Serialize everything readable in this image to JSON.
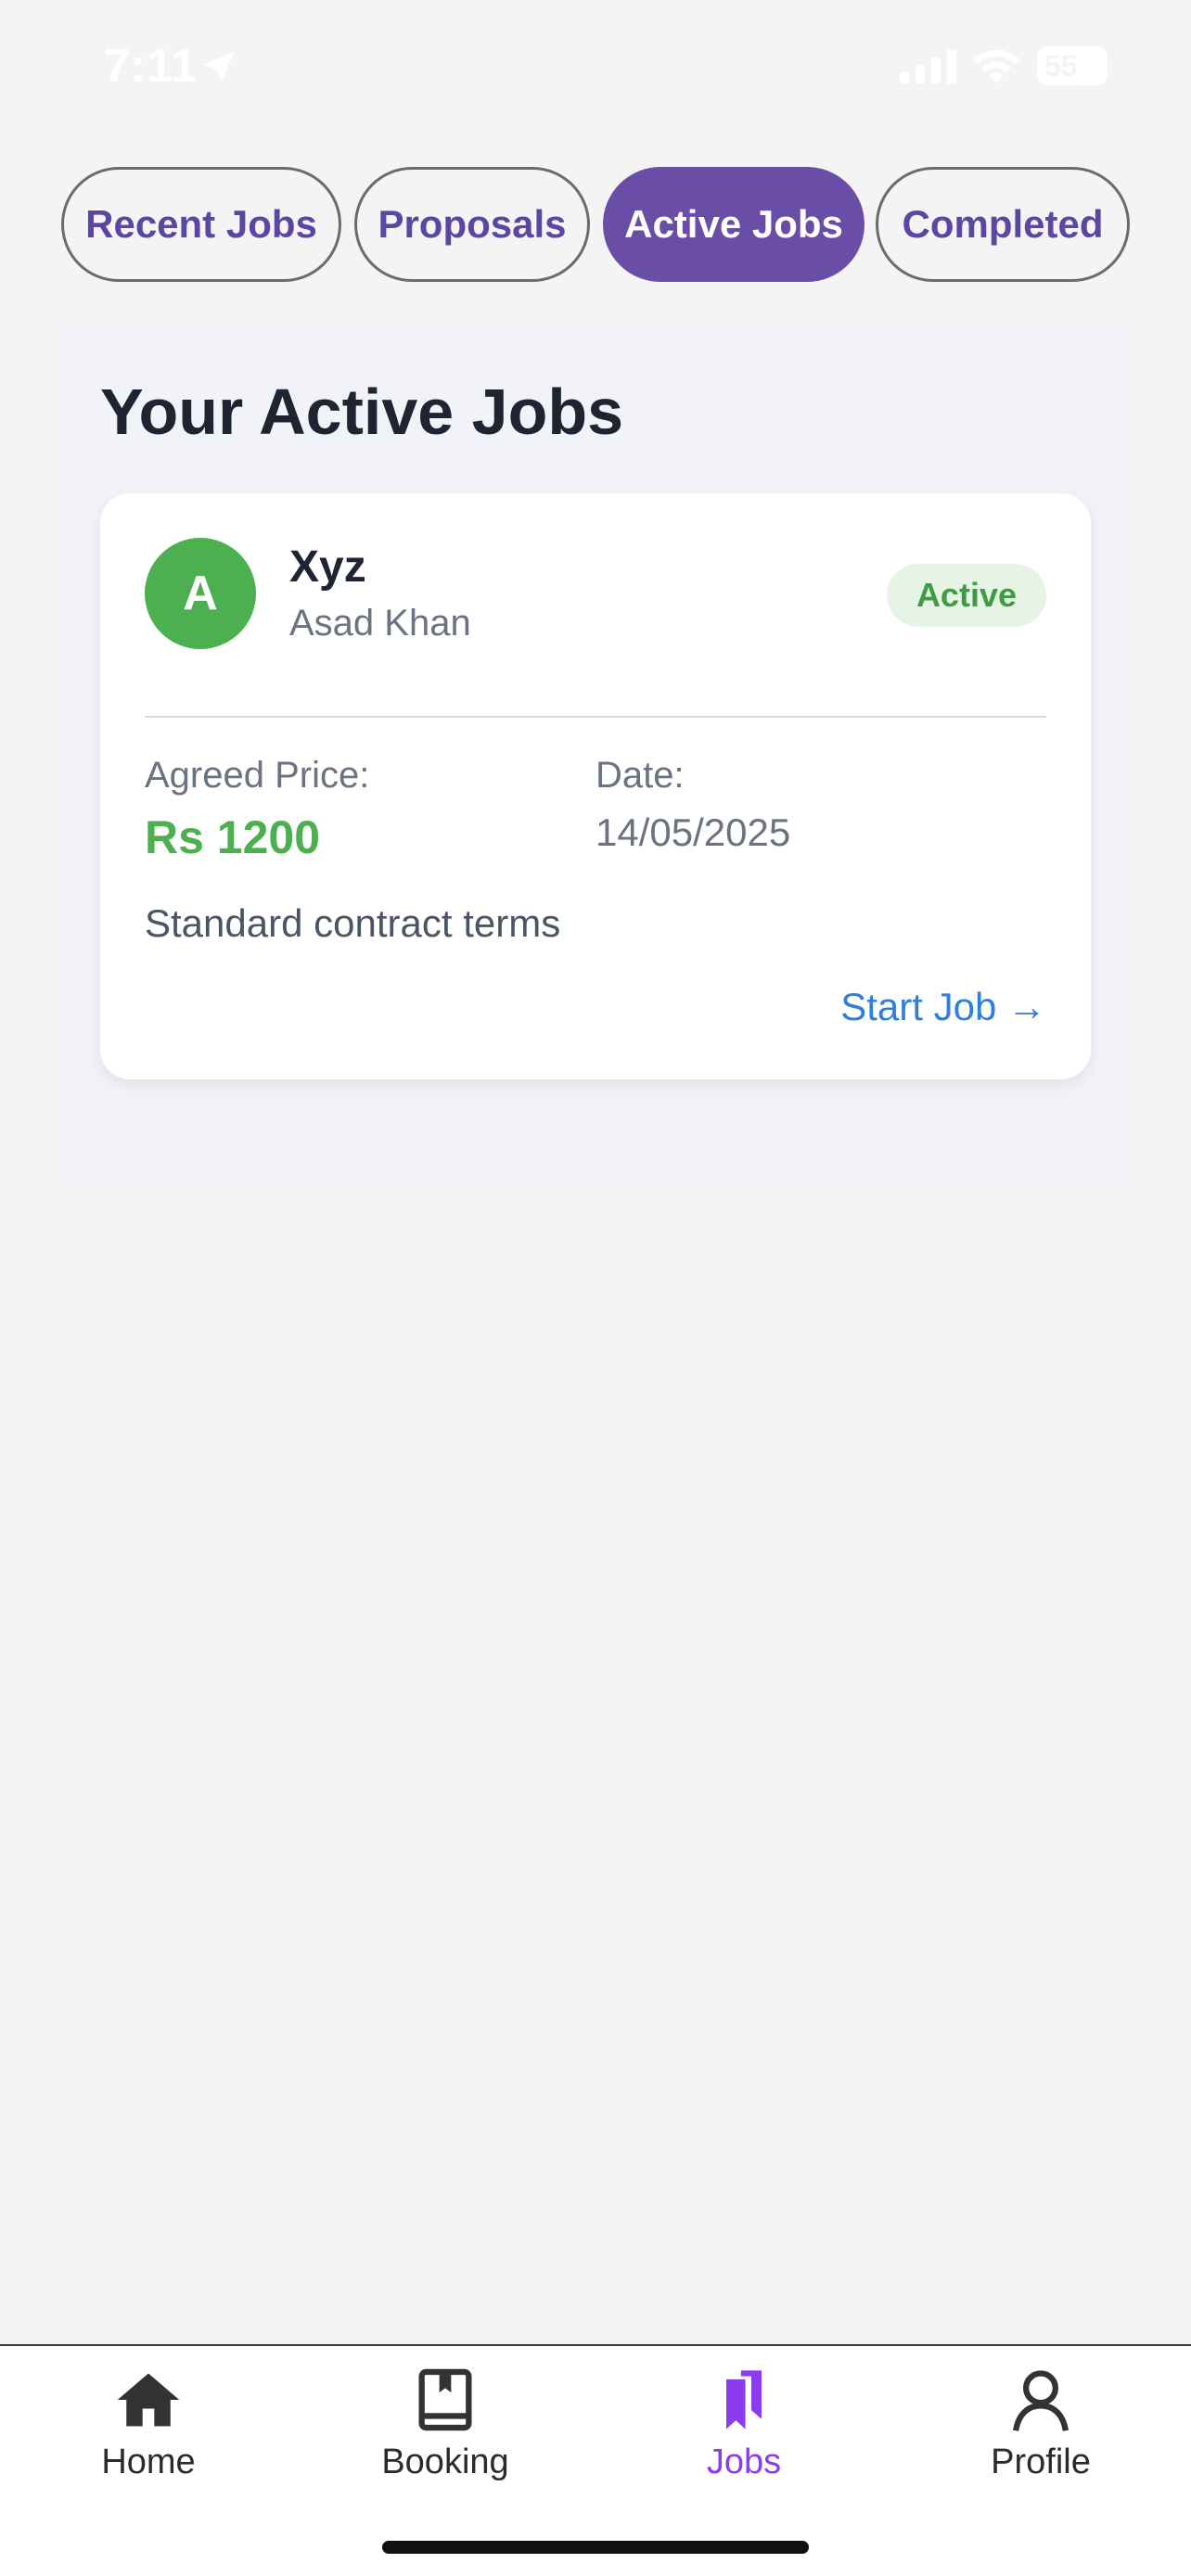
{
  "status_bar": {
    "time": "7:11",
    "battery": "55",
    "icons": [
      "location-arrow-icon",
      "signal-icon",
      "wifi-icon",
      "battery-icon"
    ]
  },
  "tabs": [
    {
      "label": "Recent Jobs",
      "active": false
    },
    {
      "label": "Proposals",
      "active": false
    },
    {
      "label": "Active Jobs",
      "active": true
    },
    {
      "label": "Completed",
      "active": false
    }
  ],
  "section": {
    "title": "Your Active Jobs"
  },
  "job_card": {
    "avatar_letter": "A",
    "title": "Xyz",
    "client": "Asad Khan",
    "status": "Active",
    "price_label": "Agreed Price:",
    "price_value": "Rs 1200",
    "date_label": "Date:",
    "date_value": "14/05/2025",
    "terms": "Standard contract terms",
    "action_label": "Start Job →"
  },
  "bottom_nav": [
    {
      "label": "Home",
      "icon": "home-icon",
      "active": false
    },
    {
      "label": "Booking",
      "icon": "book-icon",
      "active": false
    },
    {
      "label": "Jobs",
      "icon": "bookmarks-icon",
      "active": true
    },
    {
      "label": "Profile",
      "icon": "user-icon",
      "active": false
    }
  ],
  "colors": {
    "accent_purple": "#6a4da6",
    "tab_text": "#5b46a3",
    "success_green": "#4caf50",
    "link_blue": "#2f7fe0",
    "nav_active": "#8b3cf0"
  }
}
